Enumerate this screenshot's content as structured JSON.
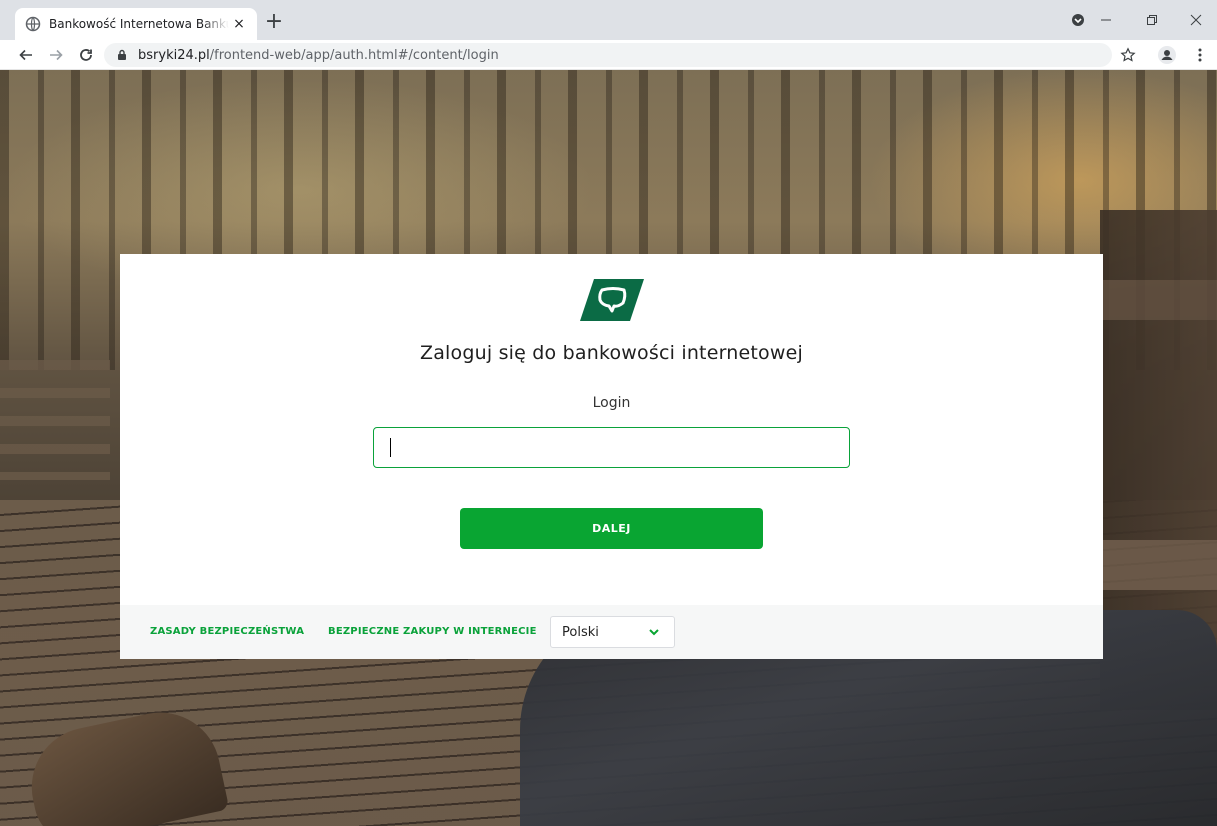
{
  "browser": {
    "tab_title": "Bankowość Internetowa Banku Spółdzielczego",
    "close_glyph": "×",
    "newtab_glyph": "+",
    "url_host": "bsryki24.pl",
    "url_path": "/frontend-web/app/auth.html#/content/login"
  },
  "login": {
    "heading": "Zaloguj się do bankowości internetowej",
    "login_label": "Login",
    "login_value": "",
    "next_button": "DALEJ"
  },
  "footer": {
    "security_link": "ZASADY BEZPIECZEŃSTWA",
    "shopping_link": "BEZPIECZNE ZAKUPY W INTERNECIE",
    "language_selected": "Polski"
  },
  "colors": {
    "brand_green": "#09a532",
    "logo_green": "#0b6b45"
  },
  "icons": {
    "favicon": "globe-icon",
    "back": "back-arrow-icon",
    "forward": "forward-arrow-icon",
    "reload": "reload-icon",
    "lock": "lock-icon",
    "bookmark": "star-icon",
    "profile": "profile-icon",
    "menu": "kebab-menu-icon",
    "extension": "extension-icon",
    "minimize": "minimize-icon",
    "maximize": "restore-icon",
    "close": "close-icon",
    "dropdown": "chevron-down-icon"
  }
}
